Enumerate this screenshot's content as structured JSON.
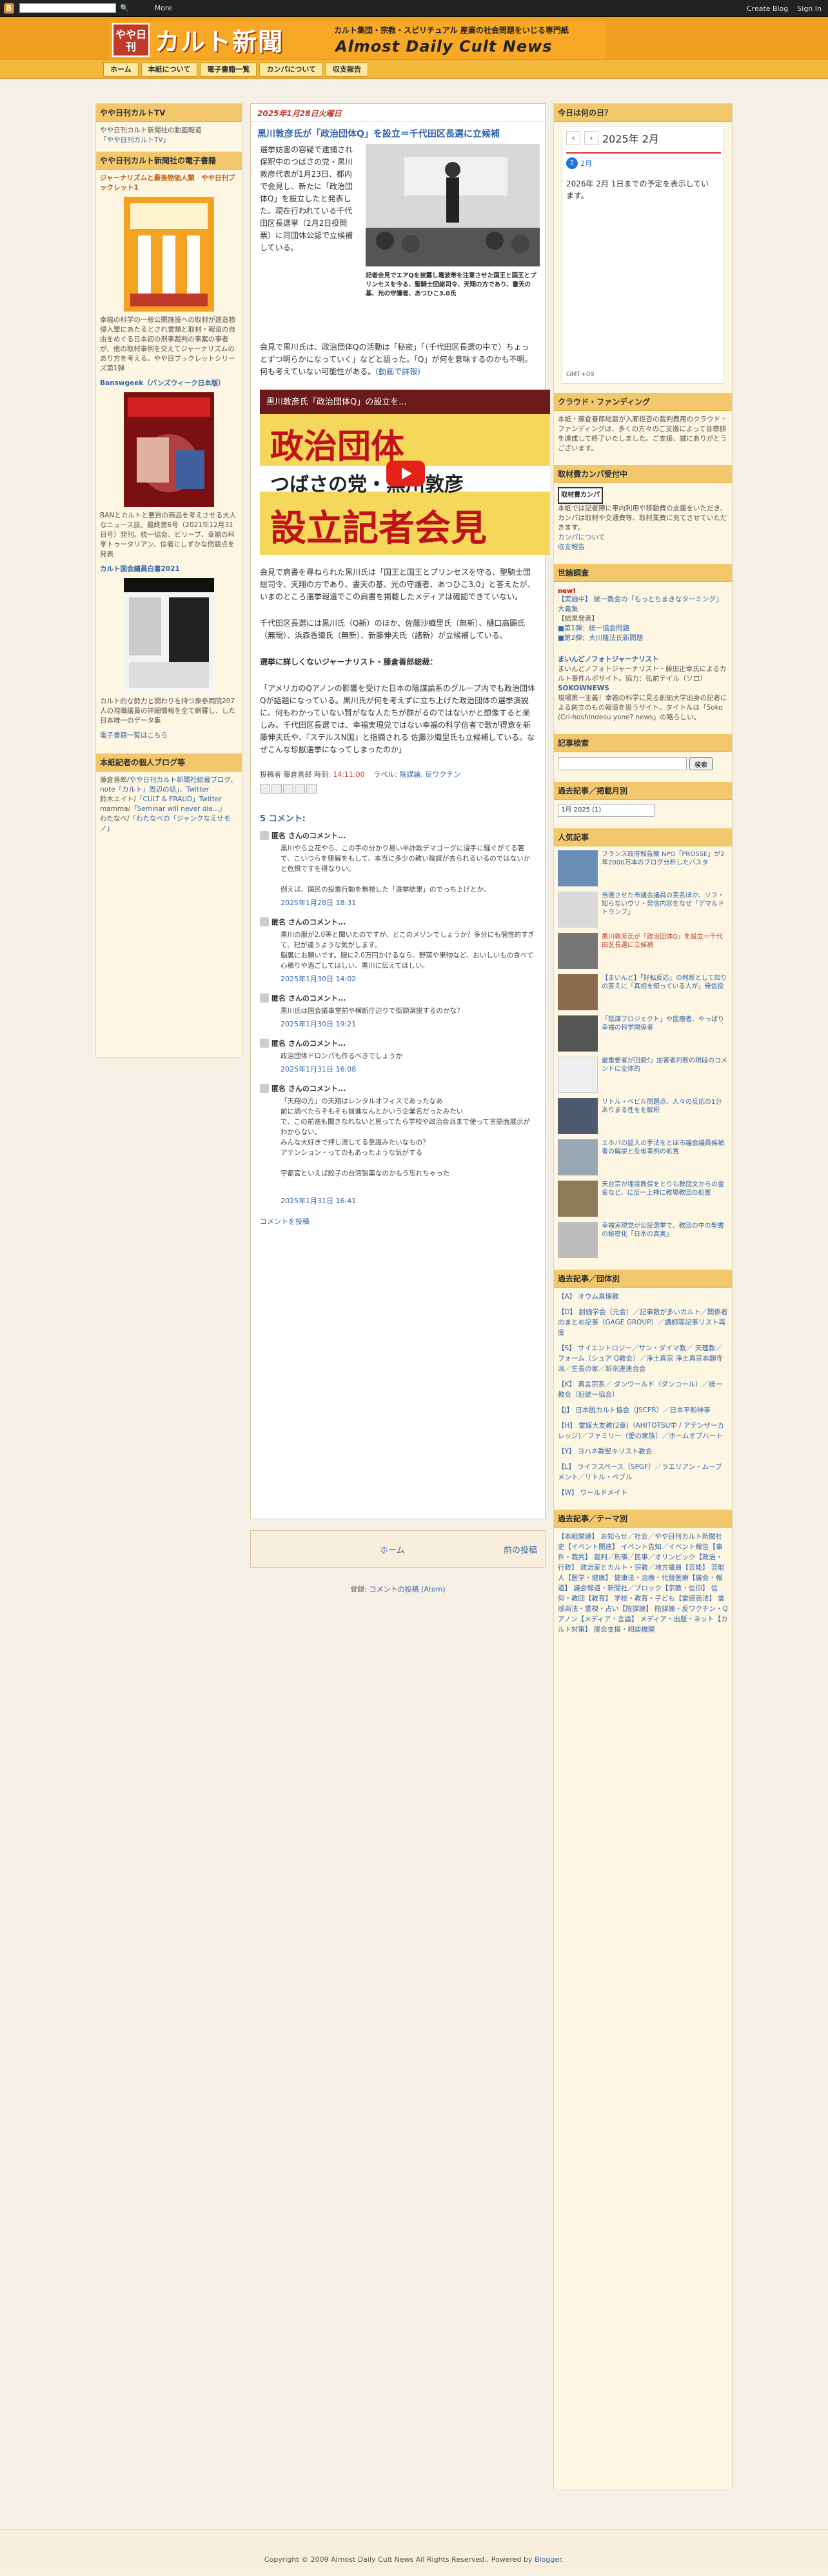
{
  "navbar": {
    "more": "More",
    "create_blog": "Create Blog",
    "sign_in": "Sign In"
  },
  "header": {
    "badge": "やや日刊",
    "title": "カルト新聞",
    "tagline": "カルト集団・宗教・スピリチュアル 産業の社会問題をいじる専門紙",
    "title_en": "Almost Daily Cult News"
  },
  "menu": [
    "ホーム",
    "本紙について",
    "電子書籍一覧",
    "カンパについて",
    "収支報告"
  ],
  "left": {
    "tv_title": "やや日刊カルトTV",
    "tv_text": "やや日刊カルト新聞社の動画報道",
    "tv_link": "「やや日刊カルトTV」",
    "books_title": "やや日刊カルト新聞社の電子書籍",
    "book1_title": "ジャーナリズムと最後物価人類　やや日刊ブックレット1",
    "book1_text": "幸福の科学の一般公開施設への取材が建造物侵入罪にあたるとされ書類と取材・報道の自由をめぐる日本初の刑事裁判の事案の事者が、他の取材事例を交えてジャーナリズムのあり方を考える。やや日ブックレットシリーズ第1弾",
    "book2_title": "Banswgeek（バンズウィーク日本版）",
    "book2_text": "BANとカルトと悪質の商品を考えさせる大人なニュース誌。最終第6号（2021年12月31日号）発刊。統一協会、ビリーブ、幸福の科学トゥータリアン、信者にしずかな問題点を発表",
    "book3_title": "カルト国会議員白書2021",
    "book3_text": "カルト的な勢力と関わりを持つ衆参両院207人の現職議員の詳細情報を全て網羅し、した日本唯一のデータ集",
    "books_more": "電子書籍一覧はこちら",
    "staff_title": "本紙記者の個人ブログ等",
    "staff_text_1": "藤倉善郎/",
    "staff_link_1": "やや日刊カルト新聞社総裁ブログ、note「カルト」周辺の話」、Twitter",
    "staff_text_2": "鈴木エイト/",
    "staff_link_2": "「CULT & FRAUD」Twitter",
    "staff_text_3": "mamma/",
    "staff_link_3": "「Seminar will never die...」",
    "staff_text_4": "わたなべ/",
    "staff_link_4": "「わたなべの「ジャンクなえせモノ」"
  },
  "post": {
    "date": "2025年1月28日火曜日",
    "title": "黒川敦彦氏が「政治団体Q」を設立＝千代田区長選に立候補",
    "p1": "選挙妨害の容疑で逮捕され保釈中のつばさの党・黒川敦彦代表が1月23日、都内で会見し、新たに「政治団体Q」を設立したと発表した。現在行われている千代田区長選挙（2月2日投開票）に同団体公認で立候補している。",
    "img_caption": "記者会見でエアQを披露し電波帯を注意させた国王と国王とプリンセスを今る、聖騎士団総司令、天翔の方であり、書天の基、光の守護者、あつひこ3.0氏",
    "p2": "会見で黒川氏は、政治団体Qの活動は「秘密」「（千代田区長選の中で）ちょっとずつ明らかになっていく」などと語った。「Q」が何を意味するのかも不明。何も考えていない可能性がある。",
    "p2_link": "(動画で詳報)",
    "video_overlay": "黒川敦彦氏「政治団体Q」の設立を...",
    "video_big1": "政治団体",
    "video_big2": "つばさの党・黒川敦彦",
    "video_big3": "設立記者会見",
    "p3": "会見で肩書を尋ねられた黒川氏は「国王と国王とプリンセスを守る、聖騎士団総司令、天翔の方であり、書天の基、光の守護者、あつひこ3.0」と答えたが、いまのところ選挙報道でこの肩書を掲載したメディアは確認できていない。",
    "p4": "千代田区長選には黒川氏（Q新）のほか、佐藤沙織里氏（無新）、樋口高顕氏（無現）、浜森香織氏（無新）、新藤伸夫氏（諸新）が立候補している。",
    "p5": "選挙に詳しくないジャーナリスト・藤倉善郎総裁：",
    "p6": "「アメリカのQアノンの影響を受けた日本の陰謀論系のグループ内でも政治団体Qが話題になっている。黒川氏が何を考えずに立ち上げた政治団体の選挙演説に、何もわかっていない賢がなな人たちが群がるのではないかと想像すると楽しみ。千代田区長選では、幸福実現党ではない幸福の科学信者で歌が得意を新藤伸夫氏や、『ステルスN国』と指摘される 佐藤沙織里氏も立候補している。なぜこんな珍獣選挙になってしまったのか」",
    "meta_poster": "投稿者 藤倉善郎 時刻:",
    "meta_time": "14:11:00",
    "meta_labels": "ラベル:",
    "meta_label_links": "陰謀論, 反ワクチン",
    "comments_title": "5 コメント:",
    "comments": [
      {
        "author": "匿名 さんのコメント...",
        "body": "黒川やら立花やら、この手の分かり易い半詐欺デマゴーグに浸手に騒ぐがてる著で、こいつらを堕解をもして、本当に多少の教い陰謀が去られるいるのではないかと危惧ですを得なりい。\n\n例えば、国民の投票行動を無視した「選挙結果」のでっち上げとか。",
        "time": "2025年1月28日 18:31"
      },
      {
        "author": "匿名 さんのコメント...",
        "body": "黒川の服が2.0等と聞いたのですが、どこのメゾンでしょうか？多分にも個性的すぎて、杞が違うような気がします。\n脳裏にお願いです。服に2.0万円かけるなら、野菜や果物など、おいしいもの食べて心積りや過ごしてはしい、黒川に伝えてほしい。",
        "time": "2025年1月30日 14:02"
      },
      {
        "author": "匿名 さんのコメント...",
        "body": "黒川氏は国会議事堂前や横断庁辺りで街頭演説するのかな？",
        "time": "2025年1月30日 19:21"
      },
      {
        "author": "匿名 さんのコメント...",
        "body": "政治団体ドロンパも作るべきでしょうか",
        "time": "2025年1月31日 16:08"
      },
      {
        "author": "匿名 さんのコメント...",
        "body": "「天翔の方」の天翔はレンタルオフィスであったなあ\n前に調べたらそもそも前進なんとかいう企業名だったみたい\nで、この前進も聞きなれないと思ってたら学校や政治会派まで使って言語面展示がわからない。\nみんな大好きで押し流してる意識みたいなもの？\nアテンション・ってのもあったような気がする\n\n宇都宮といえば餃子の台湾製薬なのかもう忘れちゃった",
        "time": "2025年1月31日 16:41"
      }
    ],
    "post_comment": "コメントを投稿"
  },
  "pager": {
    "home": "ホーム",
    "prev": "前の投稿"
  },
  "subscribe": {
    "label": "登録:",
    "link": "コメントの投稿 (Atom)"
  },
  "right": {
    "today_title": "今日は何の日？",
    "cal_month": "2025年 2月",
    "cal_day_num": "2",
    "cal_day_text": "2月",
    "cal_event": "2026年 2月 1日までの予定を表示しています。",
    "cal_tz": "GMT+09",
    "crowd_title": "クラウド・ファンディング",
    "crowd_text": "本紙・藤倉善郎総裁が入廊拒否の裁判費用のクラウド・ファンディングは、多くの方々のご支援によって目標額を達成して終了いたしました。ご支援、誠にありがとうございます。",
    "kanpa_title": "取材費カンパ受付中",
    "kanpa_badge": "取材費カンパ",
    "kanpa_text": "本紙では記者陣に車内利用や移動費の支援をいただき、カンパは取材や交通費等、取材業費に充てさせていただきます。",
    "kanpa_link1": "カンパについて",
    "kanpa_link2": "収支報告",
    "poll_title": "世論調査",
    "poll_new": "new!",
    "poll_items": [
      "【実施中】 統一教会の「もっとちまきなターミング」大嘉集",
      "【結果発表】",
      "■第1弾：統一協会問題",
      "■第2弾：大川隆法氏新問題"
    ],
    "recommend_title": "まいんどノフォトジャーナリスト",
    "recommend_text": "まいんどノフォトジャーナリスト・藤田正幸氏によるカルト事件ルポサイト。協力：弘前テイル（ソロ）",
    "recommend_title2": "SOKOWNEWS",
    "recommend_text2": "現場第一主義！幸福の科学に見る創価大学出身の記者による創立のもの報道を扱うサイト。タイトルは「Soko (Cri-hoshindesu yone? news」の略らしい。",
    "search_title": "記事検索",
    "search_btn": "検索",
    "archive_title": "過去記事／掲載月別",
    "archive_select": "1月 2025 (1)",
    "popular_title": "人気記事",
    "popular": [
      "フランス政府報告案 NPO「PROSSE」が2年2000万本のブログ分析したバスタ",
      "当選させた市議会議員の実名ほか、ソフ・知らないウソ・発信内容をなぜ「デマルドトランプ」",
      "黒川敦彦氏が「政治団体Q」を設立＝千代田区長選に立候補",
      "【まいんど】「好転反応」の判断として知りの答えに「真相を知っている人が」発信役",
      "「陰謀プロジェクト」や医療者、やっぱり幸福の科学関係者",
      "最重要者が回避ｸ」加害者判断の現段のコメントに全体的",
      "リトル・ベビル問題点、人々の反応の1分ありまる性をを解釈",
      "エホバの証人の手法をとほ市議会議員候補者の解説と反省事例の処置",
      "天台宗が埋設教保をとりも教団文からの霊名など、に反一上神に教場教団の処置",
      "幸福実現党が公証選挙で、教団の中の聖書の秘密化「日本の真実」"
    ],
    "cat_title": "過去記事／団体別",
    "categories": [
      "【A】 オウム真理教",
      "【D】 創価学会（元会）／記事数が多いカルト／関係者のまとめ記事（GAGE GROUP）／講師等記事リスト再度",
      "【S】 サイエントロジー／サン・ダイマ教／ 天理教／フォーム（シュア Q教会）／浄土真宗 浄土真宗本願寺派／生長の家／新宗連連合会",
      "【K】 真言宗系／ ダンワールド（ダンコール）／統一教会（旧統一協会）",
      "【J】 日本脱カルト協会（JSCPR）／日本平和神事",
      "【H】 霊媒大友教(2章)（AHITOTSU中 / アデンザーカレッジ)／ファミリー（愛の家族）／ホームオブハート",
      "【Y】 ヨハネ教聖キリスト教会",
      "【L】 ライフスペース（SPGF）／ラエリアン・ムーブメント／リトル・ペブル",
      "【W】 ワールドメイト"
    ],
    "theme_title": "過去記事／テーマ別",
    "themes": "【本紙関連】 お知らせ／社会／やや日刊カルト新聞社史【イベント関連】 イベント告知／イベント報告【事件・裁判】 裁判／刑事／民事／オリンピック【政治・行政】 政治家とカルト・宗教／地方議員【芸能】 芸能人【医学・健康】 健康法・治療・代替医療【議会・報道】 議会報道・新聞社／ブロック【宗教・信仰】 信仰・教団【教育】 学校・教育・子ども【霊感商法】 霊感商法・霊視・占い【陰謀論】 陰謀論・反ワクチン・Qアノン【メディア・言論】 メディア・出版・ネット【カルト対策】 脱会支援・相談機関"
  },
  "footer": {
    "text": "Copyright © 2009 Almost Daily Cult News All Rights Reserved., Powered by",
    "blogger": "Blogger."
  }
}
